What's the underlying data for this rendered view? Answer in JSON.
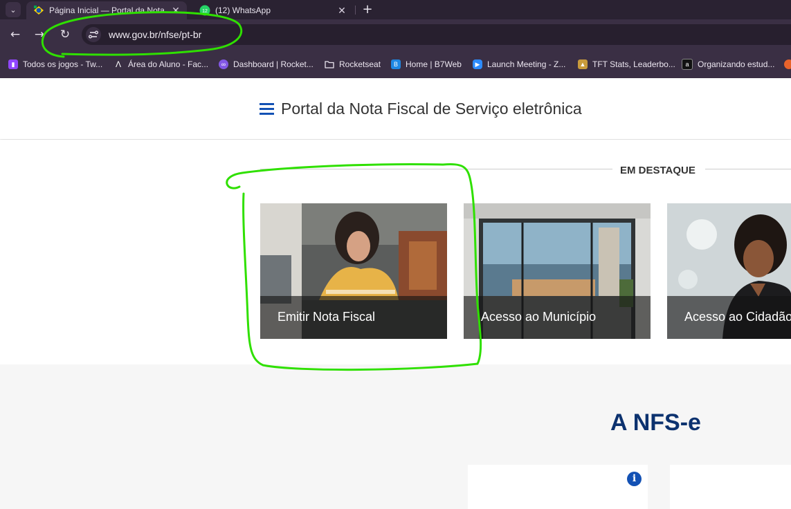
{
  "browser": {
    "tabs": [
      {
        "title": "Página Inicial — Portal da Nota",
        "active": true,
        "icon": "gov-br-icon"
      },
      {
        "title": "(12) WhatsApp",
        "active": false,
        "icon": "whatsapp-icon",
        "badge": "12"
      }
    ],
    "url": "www.gov.br/nfse/pt-br",
    "bookmarks": [
      {
        "label": "Todos os jogos - Tw...",
        "icon": "twitch-icon",
        "color": "#9146ff"
      },
      {
        "label": "Área do Aluno - Fac...",
        "icon": "alura-icon",
        "color": "#000000"
      },
      {
        "label": "Dashboard | Rocket...",
        "icon": "rocketseat-icon",
        "color": "#8257e5"
      },
      {
        "label": "Rocketseat",
        "icon": "folder-icon",
        "color": "#ece6f0"
      },
      {
        "label": "Home | B7Web",
        "icon": "b7web-icon",
        "color": "#1e88e5"
      },
      {
        "label": "Launch Meeting - Z...",
        "icon": "zoom-icon",
        "color": "#2d8cff"
      },
      {
        "label": "TFT Stats, Leaderbo...",
        "icon": "tft-icon",
        "color": "#c89b3c"
      },
      {
        "label": "Organizando estud...",
        "icon": "alura-a-icon",
        "color": "#111111"
      }
    ]
  },
  "header": {
    "title": "Portal da Nota Fiscal de Serviço eletrônica"
  },
  "highlight": {
    "label": "EM DESTAQUE",
    "cards": [
      {
        "label": "Emitir Nota Fiscal"
      },
      {
        "label": "Acesso ao Município"
      },
      {
        "label": "Acesso ao Cidadão"
      }
    ]
  },
  "section": {
    "title": "A NFS-e",
    "info_glyph": "i"
  },
  "colors": {
    "brand_blue": "#1351b4",
    "title_navy": "#0c326f",
    "annotation_green": "#2fe000"
  }
}
